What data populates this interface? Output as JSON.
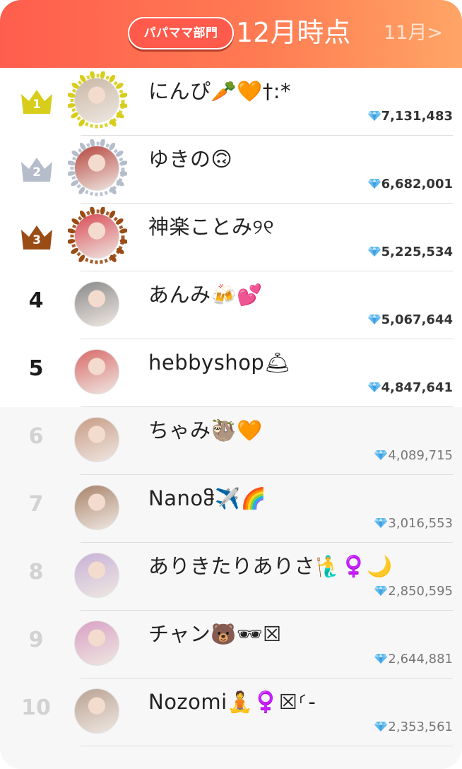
{
  "header": {
    "category_label": "パパママ部門",
    "current_month": "12月時点",
    "prev_month_link": "11月>",
    "colors": {
      "gradient_start": "#ff5e4e",
      "gradient_end": "#ffa566"
    }
  },
  "ranking": [
    {
      "rank": "1",
      "name": "にんぴ🥕🧡†:*",
      "score": "7,131,483",
      "badge": "gold-crown",
      "avatar_color": "#c9b7a6"
    },
    {
      "rank": "2",
      "name": "ゆきの🙃",
      "score": "6,682,001",
      "badge": "silver-crown",
      "avatar_color": "#b6463f"
    },
    {
      "rank": "3",
      "name": "神楽ことみ୨୧",
      "score": "5,225,534",
      "badge": "bronze-crown",
      "avatar_color": "#d94a55"
    },
    {
      "rank": "4",
      "name": "あんみ🍻💕",
      "score": "5,067,644",
      "badge": "",
      "avatar_color": "#8a8a8a"
    },
    {
      "rank": "5",
      "name": "hebbyshop🛎",
      "score": "4,847,641",
      "badge": "",
      "avatar_color": "#d96a6a"
    },
    {
      "rank": "6",
      "name": "ちゃみ🦥🧡",
      "score": "4,089,715",
      "badge": "",
      "avatar_color": "#c89b86"
    },
    {
      "rank": "7",
      "name": "Nanoჵ✈️🌈",
      "score": "3,016,553",
      "badge": "",
      "avatar_color": "#a8836a"
    },
    {
      "rank": "8",
      "name": "ありきたりありさ🧜‍♂️♀️🌙",
      "score": "2,850,595",
      "badge": "",
      "avatar_color": "#c7b2d8"
    },
    {
      "rank": "9",
      "name": "チャン🐻🕶☒",
      "score": "2,644,881",
      "badge": "",
      "avatar_color": "#d9a0c5"
    },
    {
      "rank": "10",
      "name": "Nozomi🧘♀️☒⸂-",
      "score": "2,353,561",
      "badge": "",
      "avatar_color": "#b9a293"
    }
  ],
  "crown_colors": {
    "gold": "#d7cd1a",
    "silver": "#b5bdcb",
    "bronze": "#9a4c15"
  },
  "icons": {
    "gem": "diamond-icon",
    "crown": "crown-icon",
    "wreath": "laurel-wreath-icon"
  }
}
